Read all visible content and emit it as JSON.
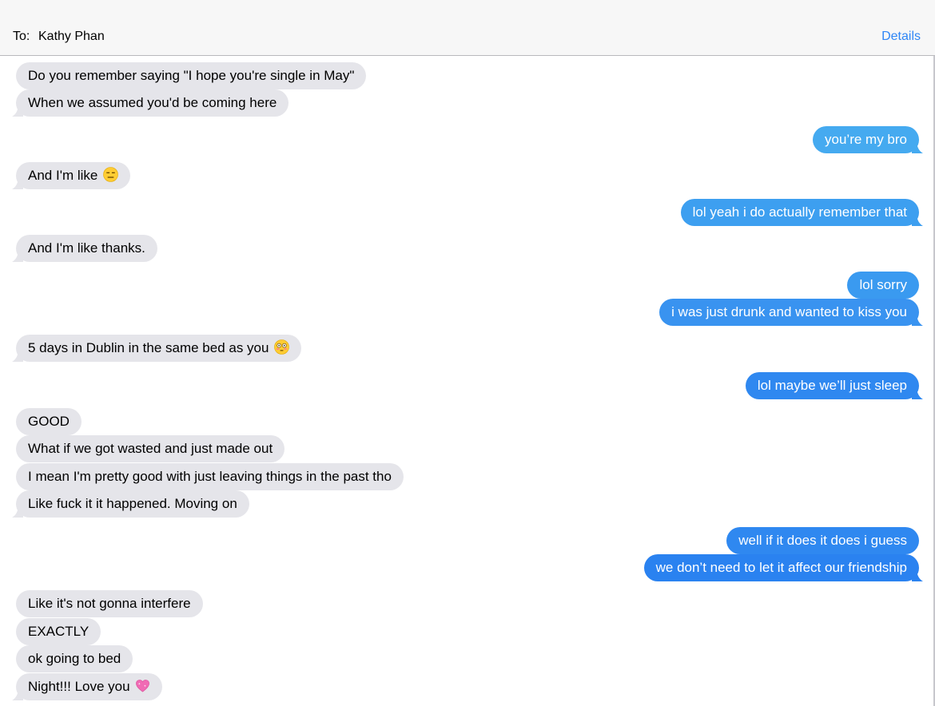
{
  "header": {
    "to_label": "To:",
    "recipient": "Kathy Phan",
    "details_label": "Details"
  },
  "colors": {
    "incoming": "#e5e5ea",
    "outgoing_light": "#45aaf0",
    "outgoing_dark": "#2a82f0",
    "link": "#2f86f6"
  },
  "messages": [
    {
      "text": "Do you remember saying \"I hope you're single in May\"",
      "from": "them"
    },
    {
      "text": "When we assumed you'd be coming here",
      "from": "them"
    },
    {
      "text": "you’re my bro",
      "from": "me"
    },
    {
      "text": "And I'm like",
      "from": "them",
      "emoji": "expressionless-face-emoji"
    },
    {
      "text": "lol yeah i do actually remember that",
      "from": "me"
    },
    {
      "text": "And I'm like thanks.",
      "from": "them"
    },
    {
      "text": "lol sorry",
      "from": "me"
    },
    {
      "text": "i was just drunk and wanted to kiss you",
      "from": "me"
    },
    {
      "text": "5 days in Dublin in the same bed as you",
      "from": "them",
      "emoji": "flushed-face-emoji"
    },
    {
      "text": "lol maybe we’ll just sleep",
      "from": "me"
    },
    {
      "text": "GOOD",
      "from": "them"
    },
    {
      "text": "What if we got wasted and just made out",
      "from": "them"
    },
    {
      "text": "I mean I'm pretty good with just leaving things in the past tho",
      "from": "them"
    },
    {
      "text": "Like fuck it it happened. Moving on",
      "from": "them"
    },
    {
      "text": "well if it does it does i guess",
      "from": "me"
    },
    {
      "text": "we don’t need to let it affect our friendship",
      "from": "me"
    },
    {
      "text": "Like it's not gonna interfere",
      "from": "them"
    },
    {
      "text": "EXACTLY",
      "from": "them"
    },
    {
      "text": "ok going to bed",
      "from": "them"
    },
    {
      "text": "Night!!! Love you",
      "from": "them",
      "emoji": "sparkling-heart-emoji"
    }
  ]
}
